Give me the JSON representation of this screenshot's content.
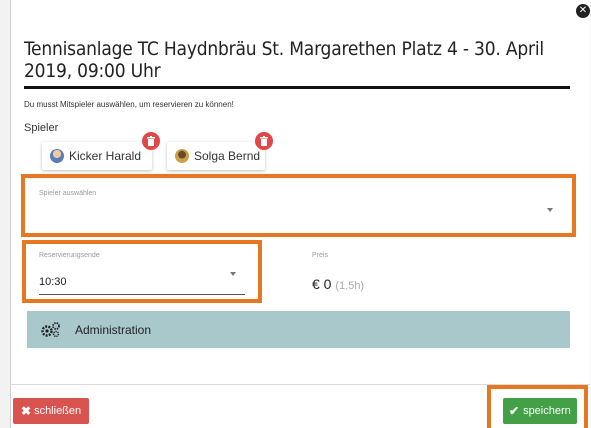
{
  "modal": {
    "title": "Tennisanlage TC Haydnbräu St. Margarethen Platz 4 - 30. April 2019, 09:00 Uhr",
    "hint": "Du musst Mitspieler auswählen, um reservieren zu können!",
    "players_label": "Spieler",
    "players": [
      {
        "name": "Kicker Harald"
      },
      {
        "name": "Solga Bernd"
      }
    ],
    "select_player": {
      "label": "Spieler auswählen",
      "value": ""
    },
    "reservation_end": {
      "label": "Reservierungsende",
      "value": "10:30"
    },
    "price": {
      "label": "Preis",
      "value": "€ 0",
      "duration": "(1.5h)"
    },
    "admin": {
      "label": "Administration",
      "icon": "gears-icon"
    },
    "buttons": {
      "close_label": "schließen",
      "save_label": "speichern"
    }
  },
  "colors": {
    "highlight": "#e87722",
    "admin_bar": "#a9c8cc",
    "danger": "#d9534f",
    "success": "#43a047"
  }
}
